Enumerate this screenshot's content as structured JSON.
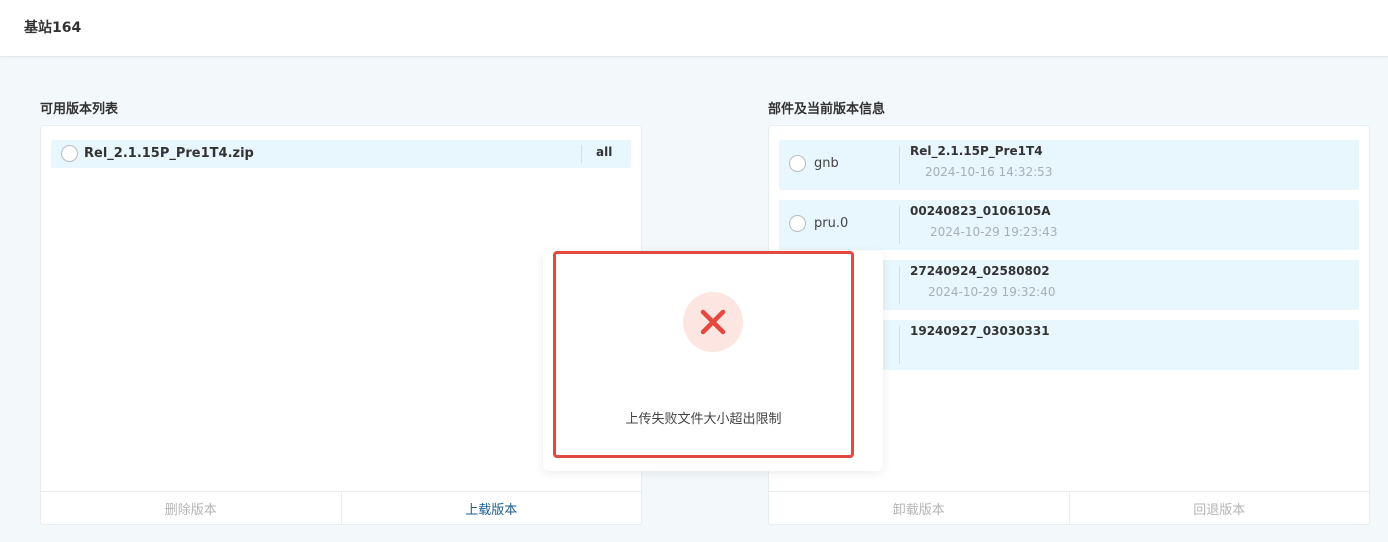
{
  "header": {
    "title": "基站164"
  },
  "left": {
    "title": "可用版本列表",
    "files": [
      {
        "name": "Rel_2.1.15P_Pre1T4.zip",
        "tag": "all"
      }
    ],
    "buttons": {
      "delete": "删除版本",
      "upload": "上载版本"
    }
  },
  "right": {
    "title": "部件及当前版本信息",
    "components": [
      {
        "name": "gnb",
        "version": "Rel_2.1.15P_Pre1T4",
        "time": "2024-10-16 14:32:53"
      },
      {
        "name": "pru.0",
        "version": "00240823_0106105A",
        "time": "2024-10-29 19:23:43"
      },
      {
        "name": "",
        "version": "27240924_02580802",
        "time": "2024-10-29 19:32:40"
      },
      {
        "name": "",
        "version": "19240927_03030331",
        "time": ""
      }
    ],
    "buttons": {
      "uninstall": "卸载版本",
      "rollback": "回退版本"
    }
  },
  "toast": {
    "icon": "error-x-icon",
    "message": "上传失败文件大小超出限制",
    "colors": {
      "error": "#e5483e",
      "error_bg": "#fde6e1"
    }
  }
}
